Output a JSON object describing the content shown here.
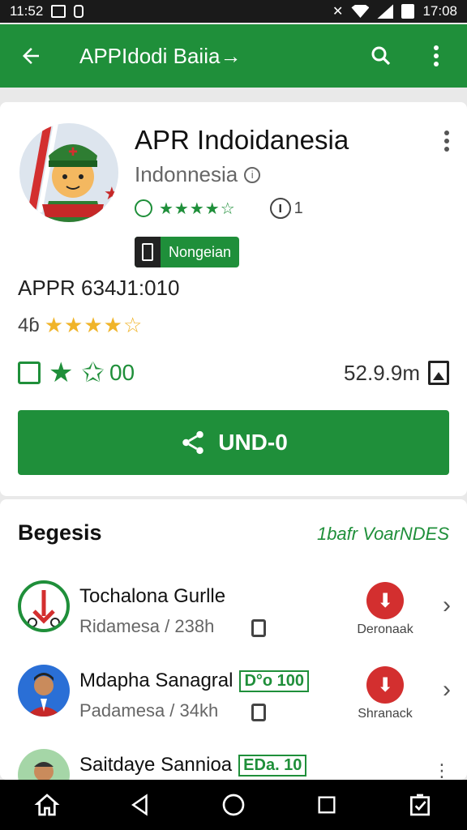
{
  "status_bar": {
    "time_left": "11:52",
    "time_right": "17:08"
  },
  "app_bar": {
    "title": "APPIdodi Baiia→"
  },
  "app": {
    "name": "APR Indoidanesia",
    "developer": "Indonnesia",
    "info_glyph": "i",
    "green_stars": "★★★★☆",
    "review_count_glyph": "I",
    "review_count": "1",
    "badge_label": "Nongeian",
    "version": "APPR 634J1:010",
    "rating_value": "4ɓ",
    "gold_stars": "★★★★☆",
    "stat_value": "00",
    "size": "52.9.9m",
    "primary_button": "UND-0"
  },
  "section": {
    "title": "Begesis",
    "link": "1bafr VoarNDES"
  },
  "list": [
    {
      "name": "Tochalona Gurlle",
      "tag": "",
      "subtitle": "Ridamesa / 238h",
      "action_label": "Deronaak"
    },
    {
      "name": "Mdapha Sanagral",
      "tag": "D°o 100",
      "subtitle": "Padamesa / 34kh",
      "action_label": "Shranack"
    },
    {
      "name": "Saitdaye Sannioa",
      "tag": "EDa. 10",
      "subtitle": "",
      "action_label": ""
    }
  ],
  "colors": {
    "brand_green": "#1f8f3a",
    "download_red": "#d32f2f",
    "star_gold": "#f0b429"
  },
  "icons": [
    "back-arrow-icon",
    "search-icon",
    "more-vert-icon",
    "info-icon",
    "verified-icon",
    "phone-icon",
    "share-icon",
    "download-icon",
    "chevron-right-icon",
    "home-icon",
    "back-triangle-icon",
    "circle-home-icon",
    "recents-icon",
    "checklist-icon"
  ]
}
